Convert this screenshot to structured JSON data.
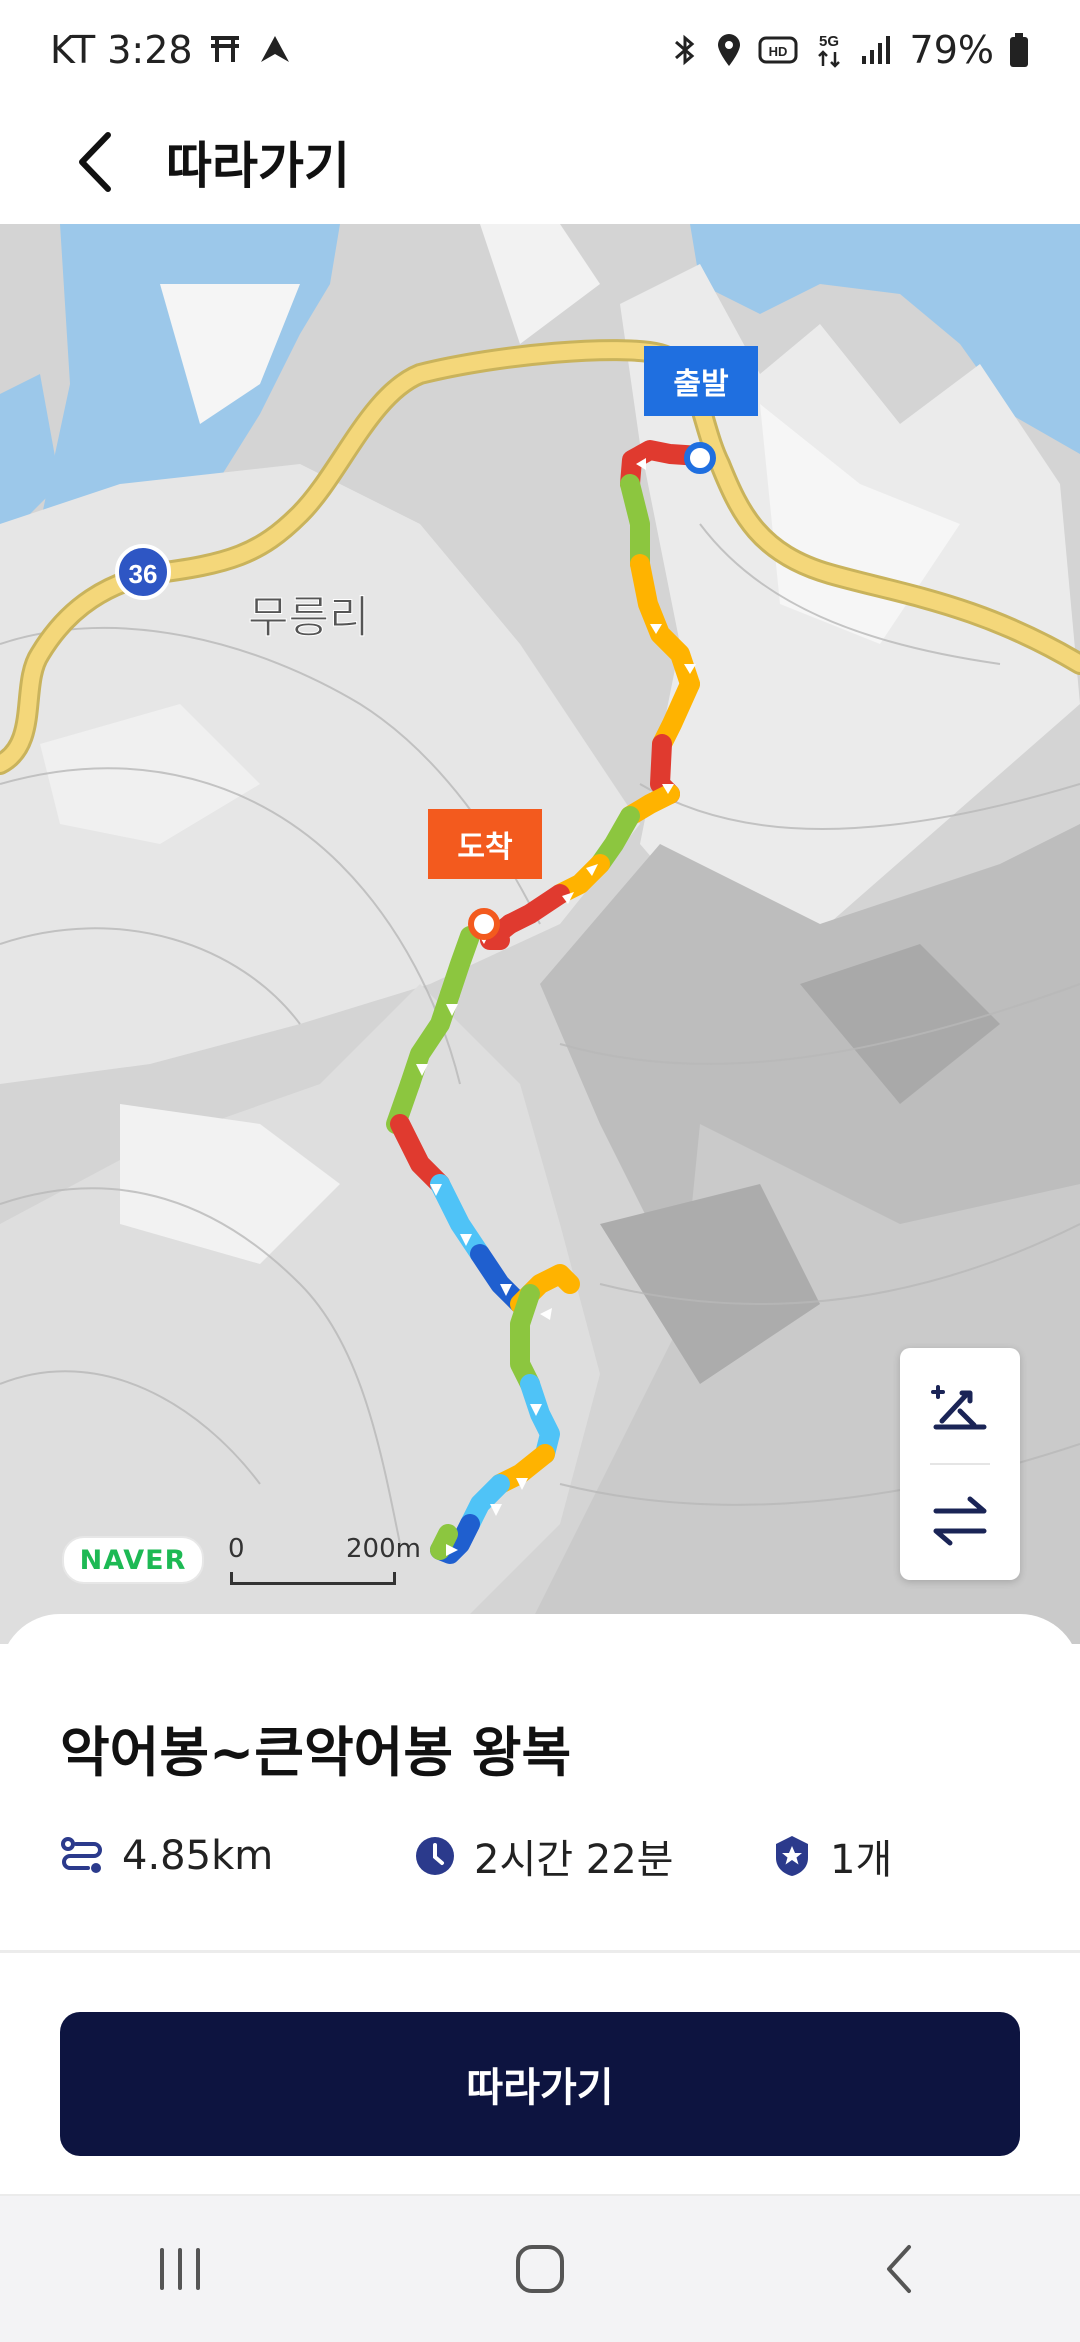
{
  "status_bar": {
    "carrier_time": "KT 3:28",
    "battery": "79%",
    "left_icons": [
      "tmap-icon",
      "navigation-app-icon"
    ],
    "right_icons": [
      "bluetooth-icon",
      "location-icon",
      "hd-icon",
      "5g-icon",
      "signal-icon",
      "battery-icon"
    ]
  },
  "app_bar": {
    "title": "따라가기",
    "back_icon": "chevron-left-icon"
  },
  "map": {
    "start_tag": "출발",
    "end_tag": "도착",
    "road_number": "36",
    "place_label": "무릉리",
    "provider": "NAVER",
    "scale_zero": "0",
    "scale_length": "200m",
    "controls": [
      "elevation-icon",
      "swap-direction-icon"
    ],
    "colors": {
      "start": "#1f6fe0",
      "end": "#f35a1e",
      "road": "#f4d77a",
      "water": "#9cc8ea"
    }
  },
  "route": {
    "name": "악어봉~큰악어봉 왕복",
    "distance": "4.85km",
    "duration": "2시간 22분",
    "badges": "1개"
  },
  "actions": {
    "follow_label": "따라가기",
    "button_color": "#0d1440"
  },
  "nav_bar": [
    "recent-apps-icon",
    "home-icon",
    "back-icon"
  ]
}
